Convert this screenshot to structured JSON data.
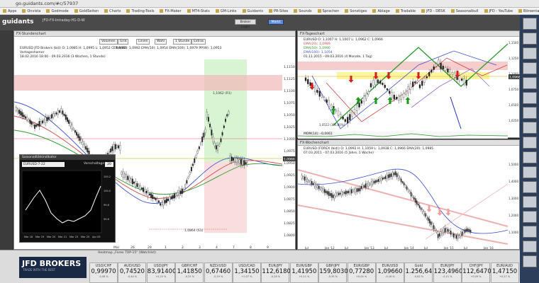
{
  "browser": {
    "url": "go.guidants.com/#c/57937",
    "bookmarks": [
      "Apps",
      "Onvista",
      "Godmode",
      "GoldSeiten",
      "Charts",
      "Trading-Tools",
      "FX-Maker",
      "MT4-Stats",
      "GM-Links",
      "Guidants",
      "PR-Sites",
      "Sounds",
      "Sprachen",
      "Sonstiges",
      "Ablage",
      "Tradable",
      "JFD - DESK",
      "Seasonalbull",
      "JFD - YouTube",
      "Börsentag Dresden"
    ]
  },
  "app": {
    "logo": "guidants",
    "tab": "JFD-FX-Intraday-H1-D-W",
    "login_label": "Broker Login",
    "markt_label": "Markt"
  },
  "left_panel": {
    "title": "FX-Stundenchart",
    "toolbar": [
      "Volumen",
      "Grid",
      "Linien",
      "Wahl",
      "1 Stunde",
      "Extras"
    ],
    "instrument": "EURUSD JFD Brokers (bid)  O: 1,0985  H: 1,0995  L: 1,0952  C: 1,0966",
    "indicators": "EMA(20): 1,0992   EMA(50): 1,0954   EMA(100): 1,0979   PP(W): 1,0953",
    "sub": "Vortageshamer",
    "date": "18.02.2016 18:00 - 09.03.2016 (3 Wochen, 1 Stunde)",
    "fib_label_top": "1,1062 (R1)",
    "fib_label_bottom": "1,0864 (S1)",
    "x_labels": [
      "Mar",
      "26",
      "29",
      "1",
      "2",
      "3",
      "4",
      "7",
      "8",
      "9"
    ],
    "y_labels": [
      "1,1150",
      "1,1125",
      "1,1100",
      "1,1075",
      "1,1050",
      "1,1025",
      "1,1000",
      "1,0975",
      "1,0950",
      "1,0925",
      "1,0900",
      "1,0875",
      "1,0850",
      "1,0825",
      "1,0800"
    ],
    "price_tag": "1,0966"
  },
  "seasonal_popup": {
    "title": "Saisonalitätsindikator",
    "select": "EURUSD-7-22",
    "option": "Vorschaltage",
    "value": "20",
    "x_labels": [
      "Mar 18",
      "Mar 19",
      "Mar 20",
      "Mar 21",
      "Mar 23",
      "Mar 25",
      "Apr 05"
    ],
    "y_labels": [
      "100.2",
      "100.0",
      "99.8",
      "99.6"
    ]
  },
  "top_right_panel": {
    "title": "FX-Tageschart",
    "instrument": "EURUSD  O: 1,1007  H: 1,1007  L: 1,0962  C: 1,0966",
    "ind1": "EMA(20): 1,0989",
    "ind2": "EMA(50): 1,0990",
    "ind3": "EMA(100): 1,1054",
    "date": "01.11.2015 - 09.03.2016 (4 Monate, 1 Tag)",
    "mom": "MOM(14): -0,0061",
    "fib_text": "1,0522 (100,00%)",
    "y_labels": [
      "1,1500",
      "1,1250",
      "1,1000",
      "1,0750",
      "1,0500",
      "1,0250"
    ],
    "price_tag": "1,0966"
  },
  "bottom_right_panel": {
    "title": "FX-Wochenchart",
    "instrument": "EURUSD (FOREX (bid))  O: 1,0992  H: 1,1059  L: 1,0938  C: 1,0966  EMA(20): 1,0985",
    "date": "07.03.2011 - 07.03.2016 (5 Jahre, 1 Woche)",
    "x_labels": [
      "Jul",
      "Jan '12",
      "Jul",
      "Jan '13",
      "Jul",
      "Jan '14",
      "Jul",
      "Jan '15",
      "Jul",
      "Jan '16"
    ],
    "y_labels": [
      "1,5000",
      "1,4000",
      "1,3000",
      "1,2000",
      "1,1000"
    ]
  },
  "heatmap": {
    "title": "Heatmap „Forex TOP-15\" (Watchlist)",
    "jfd_brand": "JFD BROKERS",
    "jfd_tag": "TRADE WITH THE BEST",
    "tiles": [
      {
        "sym": "USD/CHF",
        "val": "0,99970",
        "sub": "-0,08 %"
      },
      {
        "sym": "AUD/USD",
        "val": "0,74520",
        "sub": "-0,44 %"
      },
      {
        "sym": "USD/JPY",
        "val": "83,91400",
        "sub": "+0,22 %"
      },
      {
        "sym": "GBP/CHF",
        "val": "1,41850",
        "sub": "-0,31 %"
      },
      {
        "sym": "NZD/USD",
        "val": "0,67460",
        "sub": "-0,19 %"
      },
      {
        "sym": "USD/CAD",
        "val": "1,34150",
        "sub": "+0,07 %"
      },
      {
        "sym": "EUR/JPY",
        "val": "112,61800",
        "sub": "-0,28 %"
      },
      {
        "sym": "EUR/GBP",
        "val": "1,41950",
        "sub": "+0,11 %"
      },
      {
        "sym": "GBP/JPY",
        "val": "159,80300",
        "sub": "-0,35 %"
      },
      {
        "sym": "EUR/GBP",
        "val": "0,77280",
        "sub": "+0,04 %"
      },
      {
        "sym": "EUR/USD",
        "val": "1,09660",
        "sub": "-0,16 %"
      },
      {
        "sym": "Gold",
        "val": "1.256,64",
        "sub": "-0,62 %"
      },
      {
        "sym": "EUR/JPY",
        "val": "123,49600",
        "sub": "-0,21 %"
      },
      {
        "sym": "CHF/JPY",
        "val": "112,64700",
        "sub": "+0,09 %"
      },
      {
        "sym": "EUR/AUD",
        "val": "1,47150",
        "sub": "+0,27 %"
      }
    ]
  }
}
